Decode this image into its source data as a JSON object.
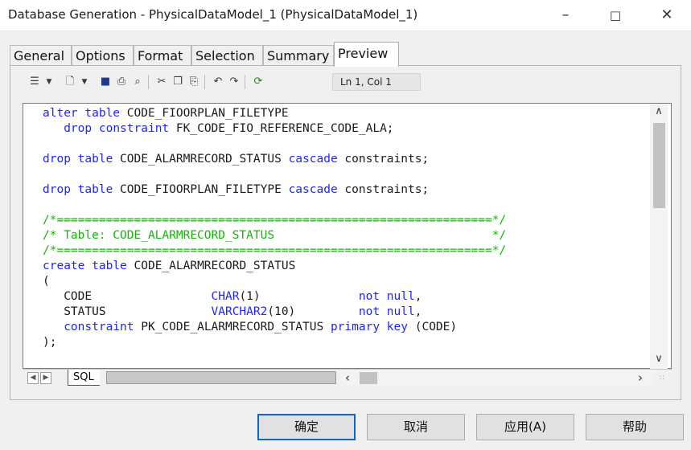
{
  "window": {
    "title": "Database Generation - PhysicalDataModel_1 (PhysicalDataModel_1)",
    "minimize_icon": "minimize-icon",
    "maximize_icon": "maximize-icon",
    "close_icon": "close-icon"
  },
  "tabs": [
    {
      "label": "General"
    },
    {
      "label": "Options"
    },
    {
      "label": "Format"
    },
    {
      "label": "Selection"
    },
    {
      "label": "Summary"
    },
    {
      "label": "Preview",
      "active": true
    }
  ],
  "toolbar": {
    "icons": [
      "properties-icon",
      "dropdown-arrow-icon",
      "new-file-icon",
      "dropdown-arrow-icon",
      "save-icon",
      "print-icon",
      "find-icon",
      "cut-icon",
      "copy-icon",
      "paste-icon",
      "undo-icon",
      "redo-icon",
      "refresh-icon"
    ],
    "position_label": "Ln 1, Col 1"
  },
  "editor": {
    "lines": [
      "alter table CODE_FIOORPLAN_FILETYPE",
      "   drop constraint FK_CODE_FIO_REFERENCE_CODE_ALA;",
      "",
      "drop table CODE_ALARMRECORD_STATUS cascade constraints;",
      "",
      "drop table CODE_FIOORPLAN_FILETYPE cascade constraints;",
      "",
      "/*==============================================================*/",
      "/* Table: CODE_ALARMRECORD_STATUS                               */",
      "/*==============================================================*/",
      "create table CODE_ALARMRECORD_STATUS",
      "(",
      "   CODE                 CHAR(1)              not null,",
      "   STATUS               VARCHAR2(10)         not null,",
      "   constraint PK_CODE_ALARMRECORD_STATUS primary key (CODE)",
      ");"
    ],
    "sheet_tab": "SQL"
  },
  "buttons": {
    "ok": "确定",
    "cancel": "取消",
    "apply": "应用(A)",
    "help": "帮助"
  },
  "colors": {
    "keyword": "#1f24ff",
    "comment": "#15b40b",
    "text": "#1a1a1a"
  }
}
